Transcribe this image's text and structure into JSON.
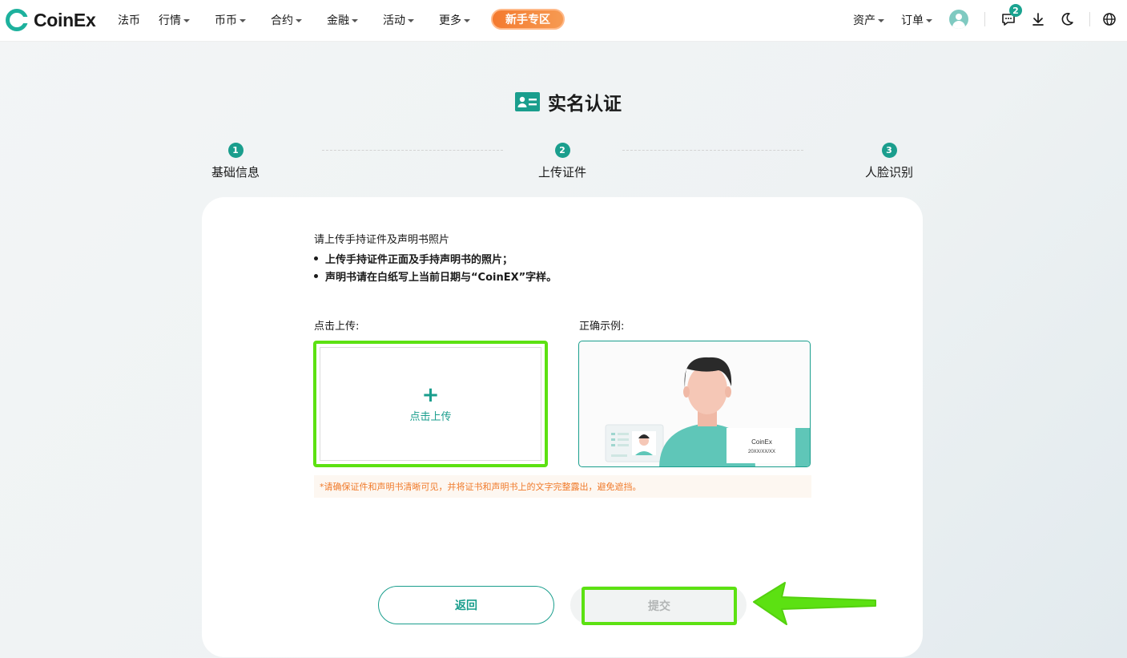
{
  "nav": {
    "brand": "CoinEx",
    "items": [
      {
        "label": "法币",
        "has_menu": false
      },
      {
        "label": "行情",
        "has_menu": true
      },
      {
        "label": "币币",
        "has_menu": true
      },
      {
        "label": "合约",
        "has_menu": true
      },
      {
        "label": "金融",
        "has_menu": true
      },
      {
        "label": "活动",
        "has_menu": true
      },
      {
        "label": "更多",
        "has_menu": true
      }
    ],
    "newbie": "新手专区",
    "assets": "资产",
    "orders": "订单",
    "message_badge": "2",
    "icons": [
      "avatar",
      "message-icon",
      "download-icon",
      "moon-icon",
      "globe-icon"
    ]
  },
  "page": {
    "title": "实名认证",
    "steps": [
      {
        "num": "1",
        "label": "基础信息"
      },
      {
        "num": "2",
        "label": "上传证件"
      },
      {
        "num": "3",
        "label": "人脸识别"
      }
    ],
    "instructions": {
      "title": "请上传手持证件及声明书照片",
      "bullets": [
        "上传手持证件正面及手持声明书的照片；",
        "声明书请在白纸写上当前日期与“CoinEX”字样。"
      ]
    },
    "upload": {
      "section_label": "点击上传:",
      "button_text": "点击上传"
    },
    "example": {
      "section_label": "正确示例:",
      "paper_line1": "CoinEx",
      "paper_line2": "20XX/XX/XX"
    },
    "tip": "*请确保证件和声明书清晰可见，并将证书和声明书上的文字完整露出，避免遮挡。",
    "buttons": {
      "back": "返回",
      "submit": "提交"
    }
  },
  "colors": {
    "accent": "#1a9e8d",
    "highlight": "#5ce112",
    "newbie": "#f47a2f",
    "tip_text": "#f07a2a"
  }
}
